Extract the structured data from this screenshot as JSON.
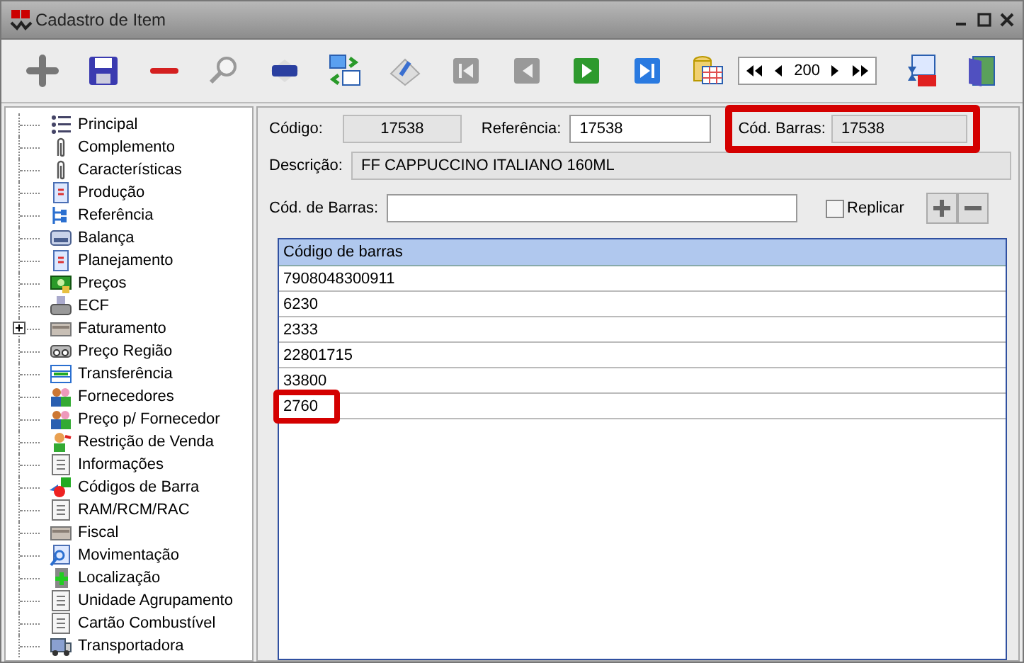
{
  "window": {
    "title": "Cadastro de Item"
  },
  "pager": {
    "value": "200"
  },
  "sidebar": {
    "items": [
      {
        "label": "Principal",
        "kind": "leaf"
      },
      {
        "label": "Complemento",
        "kind": "leaf"
      },
      {
        "label": "Características",
        "kind": "leaf"
      },
      {
        "label": "Produção",
        "kind": "leaf"
      },
      {
        "label": "Referência",
        "kind": "leaf"
      },
      {
        "label": "Balança",
        "kind": "leaf"
      },
      {
        "label": "Planejamento",
        "kind": "leaf"
      },
      {
        "label": "Preços",
        "kind": "leaf"
      },
      {
        "label": "ECF",
        "kind": "leaf"
      },
      {
        "label": "Faturamento",
        "kind": "folder",
        "expanded": false
      },
      {
        "label": "Preço Região",
        "kind": "leaf"
      },
      {
        "label": "Transferência",
        "kind": "leaf"
      },
      {
        "label": "Fornecedores",
        "kind": "leaf"
      },
      {
        "label": "Preço p/ Fornecedor",
        "kind": "leaf"
      },
      {
        "label": "Restrição de Venda",
        "kind": "leaf"
      },
      {
        "label": "Informações",
        "kind": "leaf"
      },
      {
        "label": "Códigos de Barra",
        "kind": "leaf"
      },
      {
        "label": "RAM/RCM/RAC",
        "kind": "leaf"
      },
      {
        "label": "Fiscal",
        "kind": "leaf"
      },
      {
        "label": "Movimentação",
        "kind": "leaf"
      },
      {
        "label": "Localização",
        "kind": "leaf"
      },
      {
        "label": "Unidade Agrupamento",
        "kind": "leaf"
      },
      {
        "label": "Cartão Combustível",
        "kind": "leaf"
      },
      {
        "label": "Transportadora",
        "kind": "leaf"
      }
    ]
  },
  "form": {
    "codigo": {
      "label": "Código:",
      "value": "17538"
    },
    "referencia": {
      "label": "Referência:",
      "value": "17538"
    },
    "cod_barras": {
      "label": "Cód. Barras:",
      "value": "17538",
      "highlighted": true
    },
    "descricao": {
      "label": "Descrição:",
      "value": "FF CAPPUCCINO ITALIANO 160ML"
    },
    "novo_codigo": {
      "label": "Cód. de Barras:"
    },
    "replicar": {
      "label": "Replicar",
      "checked": false
    }
  },
  "table": {
    "columns": [
      "Código de barras"
    ],
    "rows": [
      {
        "value": "7908048300911",
        "highlighted": false
      },
      {
        "value": "6230",
        "highlighted": false
      },
      {
        "value": "2333",
        "highlighted": false
      },
      {
        "value": "22801715",
        "highlighted": false
      },
      {
        "value": "33800",
        "highlighted": false
      },
      {
        "value": "2760",
        "highlighted": true
      }
    ]
  }
}
